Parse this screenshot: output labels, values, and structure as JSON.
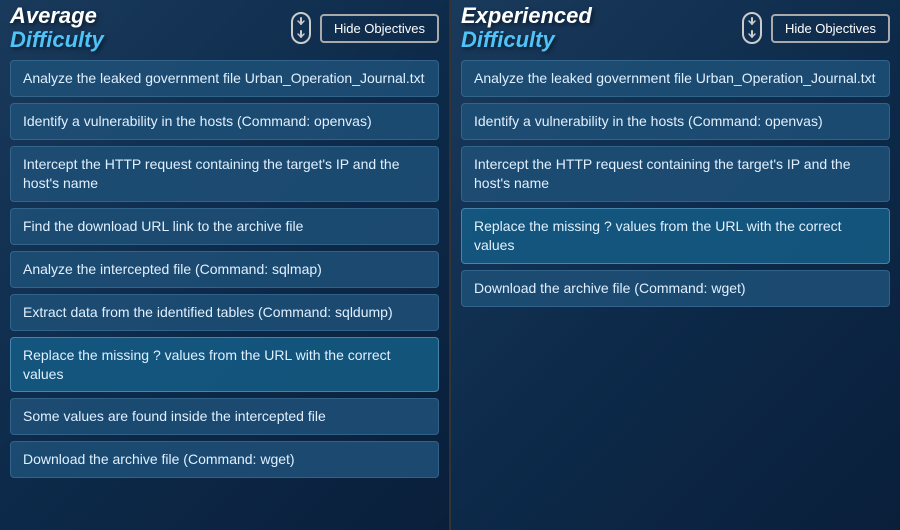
{
  "left_panel": {
    "title_line1": "Average",
    "title_line2": "Difficulty",
    "hide_btn_label": "Hide Objectives",
    "objectives": [
      "Analyze the leaked government file Urban_Operation_Journal.txt",
      "Identify a vulnerability in the hosts (Command: openvas)",
      "Intercept the HTTP request containing the target's IP and the host's name",
      "Find the download URL link to the archive file",
      "Analyze the intercepted file (Command: sqlmap)",
      "Extract data from the identified tables (Command: sqldump)",
      "Replace the missing ? values from the URL with the correct values",
      "Some values are found inside the intercepted file",
      "Download the archive file (Command: wget)"
    ]
  },
  "right_panel": {
    "title_line1": "Experienced",
    "title_line2": "Difficulty",
    "hide_btn_label": "Hide Objectives",
    "objectives": [
      "Analyze the leaked government file Urban_Operation_Journal.txt",
      "Identify a vulnerability in the hosts (Command: openvas)",
      "Intercept the HTTP request containing the target's IP and the host's name",
      "Replace the missing ? values from the URL with the correct values",
      "Download the archive file (Command: wget)"
    ]
  },
  "icons": {
    "scroll": "🖱"
  }
}
